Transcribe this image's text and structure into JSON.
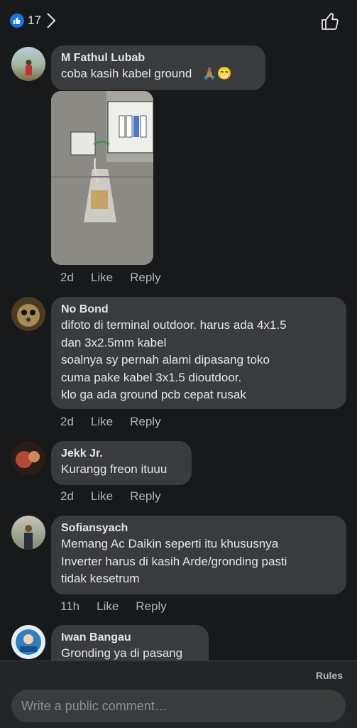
{
  "header": {
    "like_count": "17"
  },
  "comments": [
    {
      "author": "M Fathul Lubab",
      "text": "coba kasih kabel ground",
      "emoji": "🙏🏽😁",
      "time": "2d",
      "like": "Like",
      "reply": "Reply"
    },
    {
      "author": "No Bond",
      "text": "difoto di terminal outdoor. harus ada 4x1.5\ndan 3x2.5mm kabel\nsoalnya sy pernah alami dipasang toko\ncuma pake kabel 3x1.5 dioutdoor.\nklo ga ada ground pcb cepat rusak",
      "time": "2d",
      "like": "Like",
      "reply": "Reply"
    },
    {
      "author": "Jekk Jr.",
      "text": "Kurangg freon ituuu",
      "time": "2d",
      "like": "Like",
      "reply": "Reply"
    },
    {
      "author": "Sofiansyach",
      "text": "Memang Ac Daikin seperti itu khususnya\nInverter harus di kasih Arde/gronding pasti\ntidak kesetrum",
      "time": "11h",
      "like": "Like",
      "reply": "Reply"
    },
    {
      "author": "Iwan Bangau",
      "text": "Gronding ya di pasang"
    }
  ],
  "footer": {
    "rules": "Rules",
    "placeholder": "Write a public comment…"
  }
}
